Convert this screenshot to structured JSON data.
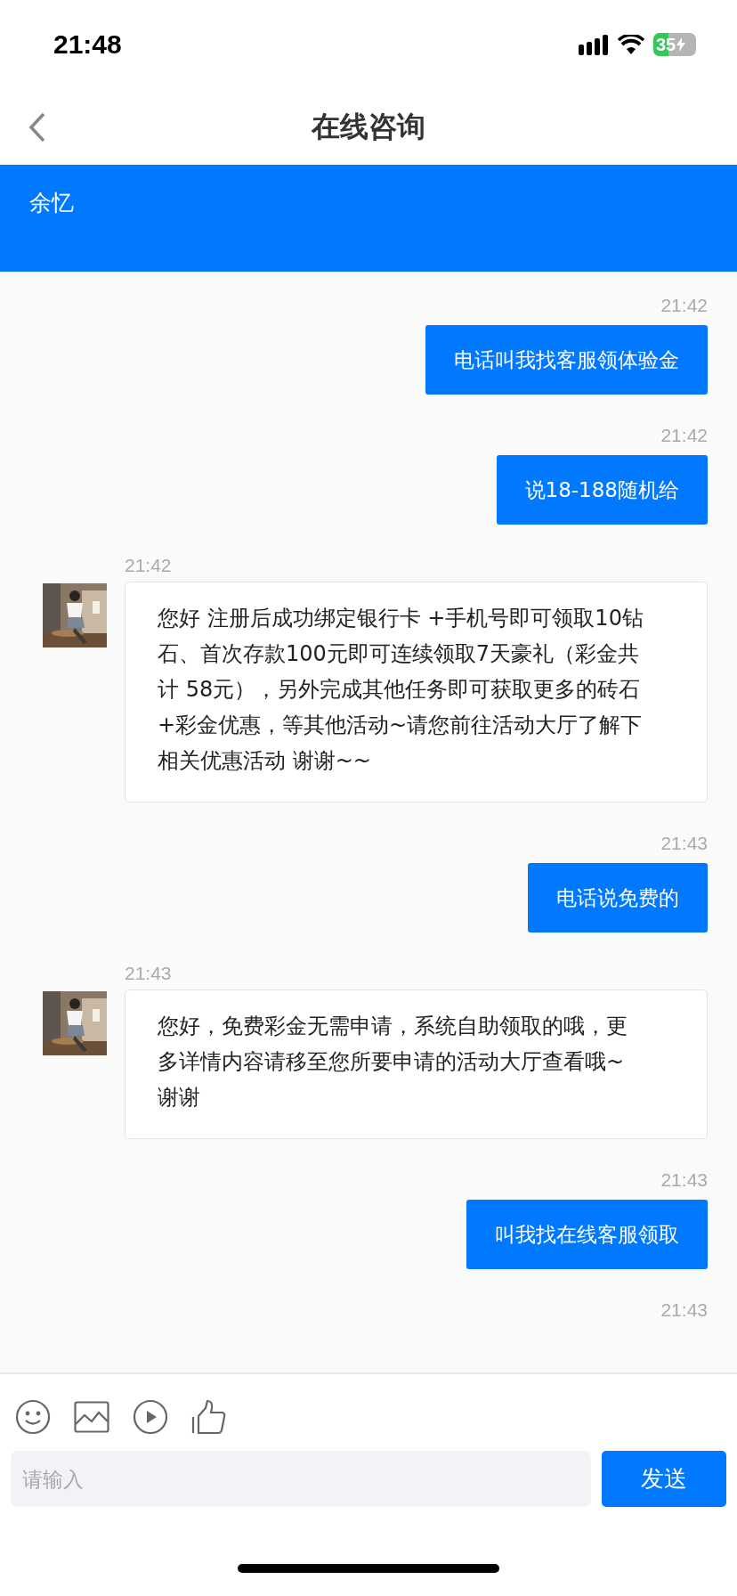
{
  "status_bar": {
    "time": "21:48",
    "battery": "35"
  },
  "nav": {
    "title": "在线咨询"
  },
  "header": {
    "name": "余忆"
  },
  "messages": [
    {
      "kind": "sent",
      "time": "21:42",
      "text": "电话叫我找客服领体验金"
    },
    {
      "kind": "sent",
      "time": "21:42",
      "text": "说18-188随机给"
    },
    {
      "kind": "received",
      "time": "21:42",
      "text": "您好 注册后成功绑定银行卡 +手机号即可领取10钻石、首次存款100元即可连续领取7天豪礼（彩金共计 58元），另外完成其他任务即可获取更多的砖石+彩金优惠，等其他活动~请您前往活动大厅了解下相关优惠活动 谢谢~~"
    },
    {
      "kind": "sent",
      "time": "21:43",
      "text": "电话说免费的"
    },
    {
      "kind": "received",
      "time": "21:43",
      "text": "您好，免费彩金无需申请，系统自助领取的哦，更多详情内容请移至您所要申请的活动大厅查看哦~谢谢"
    },
    {
      "kind": "sent",
      "time": "21:43",
      "text": "叫我找在线客服领取"
    },
    {
      "kind": "sent",
      "time": "21:43"
    }
  ],
  "composer": {
    "placeholder": "请输入",
    "send": "发送"
  }
}
